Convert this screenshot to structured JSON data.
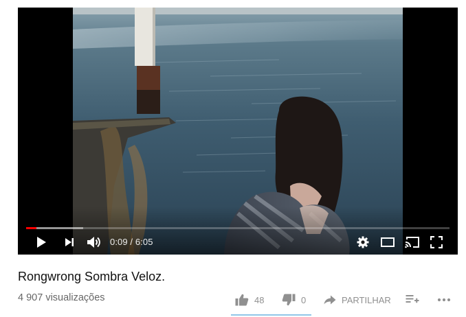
{
  "player": {
    "time_current": "0:09",
    "time_separator": "/",
    "time_total": "6:05",
    "progress_played_fraction": 0.025,
    "progress_loaded_fraction": 0.135,
    "icons": [
      "play-icon",
      "next-icon",
      "volume-icon",
      "settings-icon",
      "theater-mode-icon",
      "cast-icon",
      "fullscreen-icon"
    ],
    "accent_color": "#ff0000"
  },
  "video": {
    "title": "Rongwrong Sombra Veloz.",
    "views": "4 907 visualizações",
    "likes": "48",
    "dislikes": "0",
    "share_label": "PARTILHAR",
    "icons": [
      "thumbs-up-icon",
      "thumbs-down-icon",
      "share-icon",
      "add-to-playlist-icon",
      "more-icon"
    ]
  }
}
